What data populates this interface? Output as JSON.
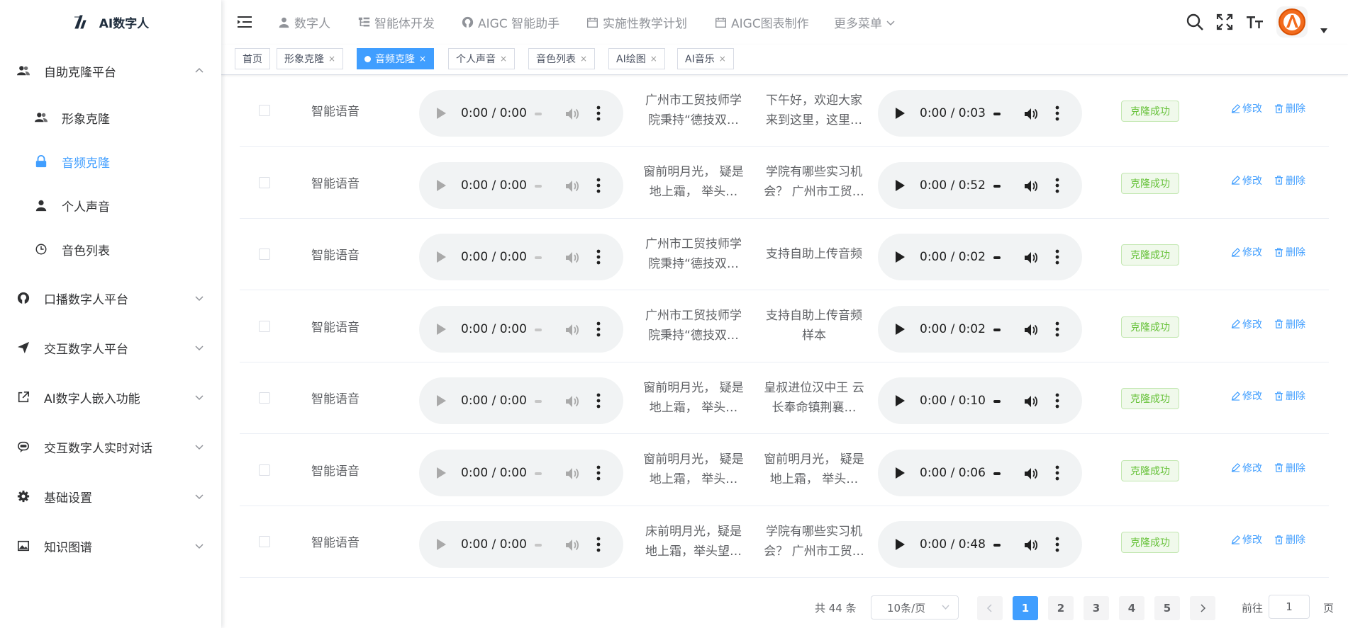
{
  "app": {
    "title": "AI数字人"
  },
  "sidebar": {
    "menus": [
      {
        "label": "自助克隆平台",
        "icon": "users-icon",
        "expanded": true
      },
      {
        "label": "口播数字人平台",
        "icon": "github-icon"
      },
      {
        "label": "交互数字人平台",
        "icon": "send-icon"
      },
      {
        "label": "AI数字人嵌入功能",
        "icon": "external-link-icon"
      },
      {
        "label": "交互数字人实时对话",
        "icon": "chat-face-icon"
      },
      {
        "label": "基础设置",
        "icon": "gear-icon"
      },
      {
        "label": "知识图谱",
        "icon": "image-icon"
      }
    ],
    "subitems": [
      {
        "label": "形象克隆",
        "icon": "users-icon"
      },
      {
        "label": "音频克隆",
        "icon": "lock-icon",
        "active": true
      },
      {
        "label": "个人声音",
        "icon": "user-icon"
      },
      {
        "label": "音色列表",
        "icon": "clock-icon"
      }
    ]
  },
  "topnav": {
    "links": [
      {
        "label": "数字人",
        "icon": "user-icon"
      },
      {
        "label": "智能体开发",
        "icon": "tree-icon"
      },
      {
        "label": "AIGC 智能助手",
        "icon": "github-icon"
      },
      {
        "label": "实施性教学计划",
        "icon": "calendar-icon"
      },
      {
        "label": "AIGC图表制作",
        "icon": "calendar-icon"
      },
      {
        "label": "更多菜单",
        "icon": "chevron-down-icon"
      }
    ]
  },
  "tags": [
    {
      "label": "首页"
    },
    {
      "label": "形象克隆",
      "close": "×"
    },
    {
      "label": "音频克隆",
      "close": "×",
      "active": true
    },
    {
      "label": "个人声音",
      "close": "×"
    },
    {
      "label": "音色列表",
      "close": "×"
    },
    {
      "label": "AI绘图",
      "close": "×"
    },
    {
      "label": "AI音乐",
      "close": "×"
    }
  ],
  "table": {
    "rows": [
      {
        "type": "智能语音",
        "src_time": "0:00 / 0:00",
        "text1": "广州市工贸技师学院秉持“德技双…",
        "text2": "下午好，欢迎大家来到这里，这里…",
        "out_time": "0:00 / 0:03",
        "status": "克隆成功"
      },
      {
        "type": "智能语音",
        "src_time": "0:00 / 0:00",
        "text1": "窗前明月光， 疑是地上霜， 举头…",
        "text2": "学院有哪些实习机会？ 广州市工贸…",
        "out_time": "0:00 / 0:52",
        "status": "克隆成功"
      },
      {
        "type": "智能语音",
        "src_time": "0:00 / 0:00",
        "text1": "广州市工贸技师学院秉持“德技双…",
        "text2": "支持自助上传音频",
        "out_time": "0:00 / 0:02",
        "status": "克隆成功"
      },
      {
        "type": "智能语音",
        "src_time": "0:00 / 0:00",
        "text1": "广州市工贸技师学院秉持“德技双…",
        "text2": "支持自助上传音频样本",
        "out_time": "0:00 / 0:02",
        "status": "克隆成功"
      },
      {
        "type": "智能语音",
        "src_time": "0:00 / 0:00",
        "text1": "窗前明月光， 疑是地上霜， 举头…",
        "text2": "皇叔进位汉中王 云长奉命镇荆襄…",
        "out_time": "0:00 / 0:10",
        "status": "克隆成功"
      },
      {
        "type": "智能语音",
        "src_time": "0:00 / 0:00",
        "text1": "窗前明月光， 疑是地上霜， 举头…",
        "text2": "窗前明月光， 疑是地上霜， 举头…",
        "out_time": "0:00 / 0:06",
        "status": "克隆成功"
      },
      {
        "type": "智能语音",
        "src_time": "0:00 / 0:00",
        "text1": "床前明月光，疑是地上霜，举头望…",
        "text2": "学院有哪些实习机会？ 广州市工贸…",
        "out_time": "0:00 / 0:48",
        "status": "克隆成功"
      }
    ],
    "actions": {
      "edit": "修改",
      "delete": "删除"
    }
  },
  "pagination": {
    "total": "共 44 条",
    "page_size": "10条/页",
    "pages": [
      "1",
      "2",
      "3",
      "4",
      "5"
    ],
    "current": "1",
    "goto_label": "前往",
    "goto_value": "1",
    "page_suffix": "页"
  },
  "colors": {
    "accent": "#409eff",
    "success": "#67c23a"
  }
}
